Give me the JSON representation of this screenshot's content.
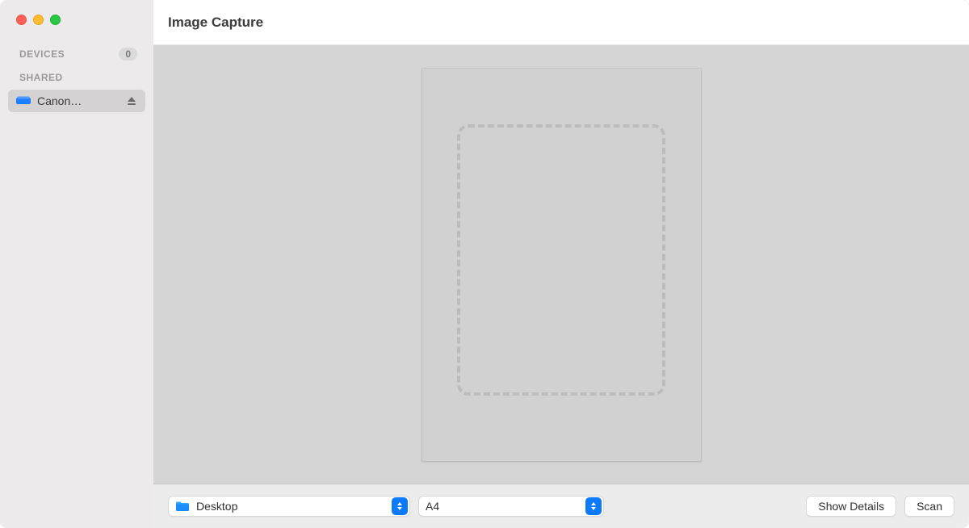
{
  "window": {
    "title": "Image Capture"
  },
  "sidebar": {
    "sections": {
      "devices": {
        "label": "DEVICES",
        "count": "0"
      },
      "shared": {
        "label": "SHARED"
      }
    },
    "items": [
      {
        "label": "Canon…",
        "icon": "scanner-icon",
        "selected": true
      }
    ]
  },
  "toolbar": {
    "destination": {
      "icon": "folder-icon",
      "selected": "Desktop"
    },
    "page_size": {
      "selected": "A4"
    },
    "show_details_label": "Show Details",
    "scan_label": "Scan"
  },
  "colors": {
    "accent": "#0a7aff",
    "sidebar_bg": "#eceaeb",
    "preview_bg": "#d5d5d5"
  }
}
